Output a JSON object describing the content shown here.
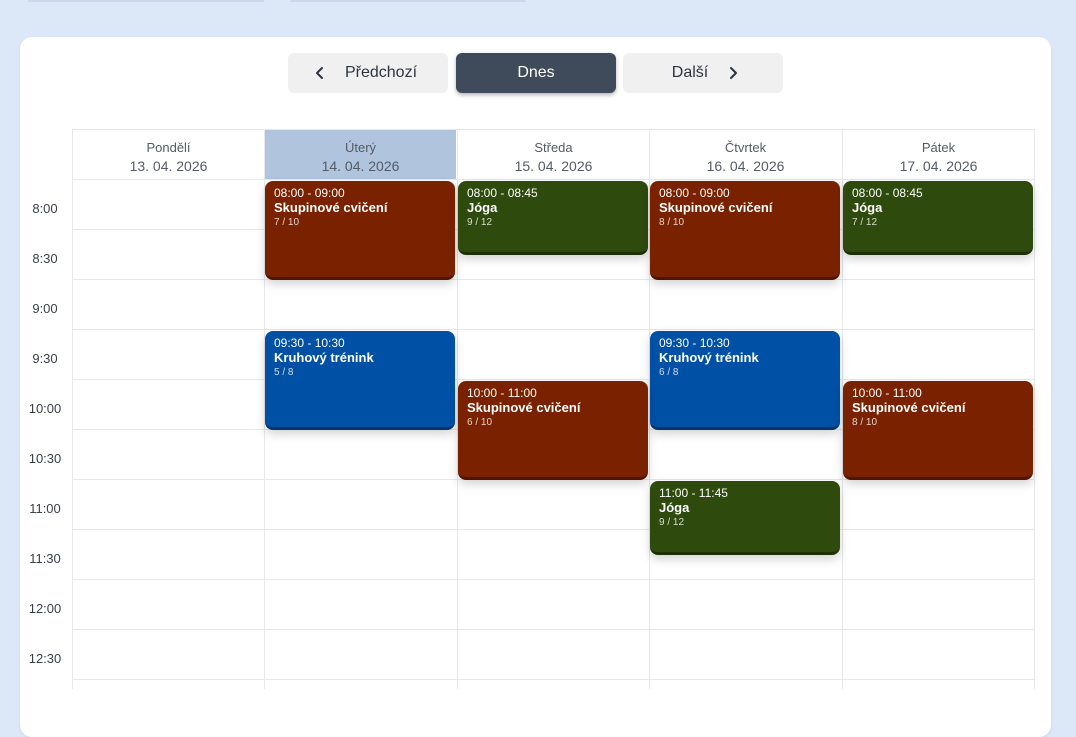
{
  "navigation": {
    "prev_label": "Předchozí",
    "today_label": "Dnes",
    "next_label": "Další",
    "prev_icon": "chevron-left-icon",
    "next_icon": "chevron-right-icon"
  },
  "colors": {
    "group_training": "#7a2100",
    "yoga": "#2e4a0d",
    "circuit_training": "#0050a6",
    "today_header": "#b0c4de",
    "today_button": "#3f4a5a"
  },
  "days": [
    {
      "name": "Pondělí",
      "date": "13. 04. 2026"
    },
    {
      "name": "Úterý",
      "date": "14. 04. 2026",
      "today": true
    },
    {
      "name": "Středa",
      "date": "15. 04. 2026"
    },
    {
      "name": "Čtvrtek",
      "date": "16. 04. 2026"
    },
    {
      "name": "Pátek",
      "date": "17. 04. 2026"
    }
  ],
  "times": [
    "8:00",
    "8:30",
    "9:00",
    "9:30",
    "10:00",
    "10:30",
    "11:00",
    "11:30",
    "12:00",
    "12:30"
  ],
  "events": [
    {
      "day": 1,
      "time": "08:00 - 09:00",
      "title": "Skupinové cvičení",
      "capacity": "7 / 10",
      "type": "group_training"
    },
    {
      "day": 2,
      "time": "08:00 - 08:45",
      "title": "Jóga",
      "capacity": "9 / 12",
      "type": "yoga"
    },
    {
      "day": 3,
      "time": "08:00 - 09:00",
      "title": "Skupinové cvičení",
      "capacity": "8 / 10",
      "type": "group_training"
    },
    {
      "day": 4,
      "time": "08:00 - 08:45",
      "title": "Jóga",
      "capacity": "7 / 12",
      "type": "yoga"
    },
    {
      "day": 1,
      "time": "09:30 - 10:30",
      "title": "Kruhový trénink",
      "capacity": "5 / 8",
      "type": "circuit_training"
    },
    {
      "day": 3,
      "time": "09:30 - 10:30",
      "title": "Kruhový trénink",
      "capacity": "6 / 8",
      "type": "circuit_training"
    },
    {
      "day": 2,
      "time": "10:00 - 11:00",
      "title": "Skupinové cvičení",
      "capacity": "6 / 10",
      "type": "group_training"
    },
    {
      "day": 4,
      "time": "10:00 - 11:00",
      "title": "Skupinové cvičení",
      "capacity": "8 / 10",
      "type": "group_training"
    },
    {
      "day": 3,
      "time": "11:00 - 11:45",
      "title": "Jóga",
      "capacity": "9 / 12",
      "type": "yoga"
    }
  ]
}
